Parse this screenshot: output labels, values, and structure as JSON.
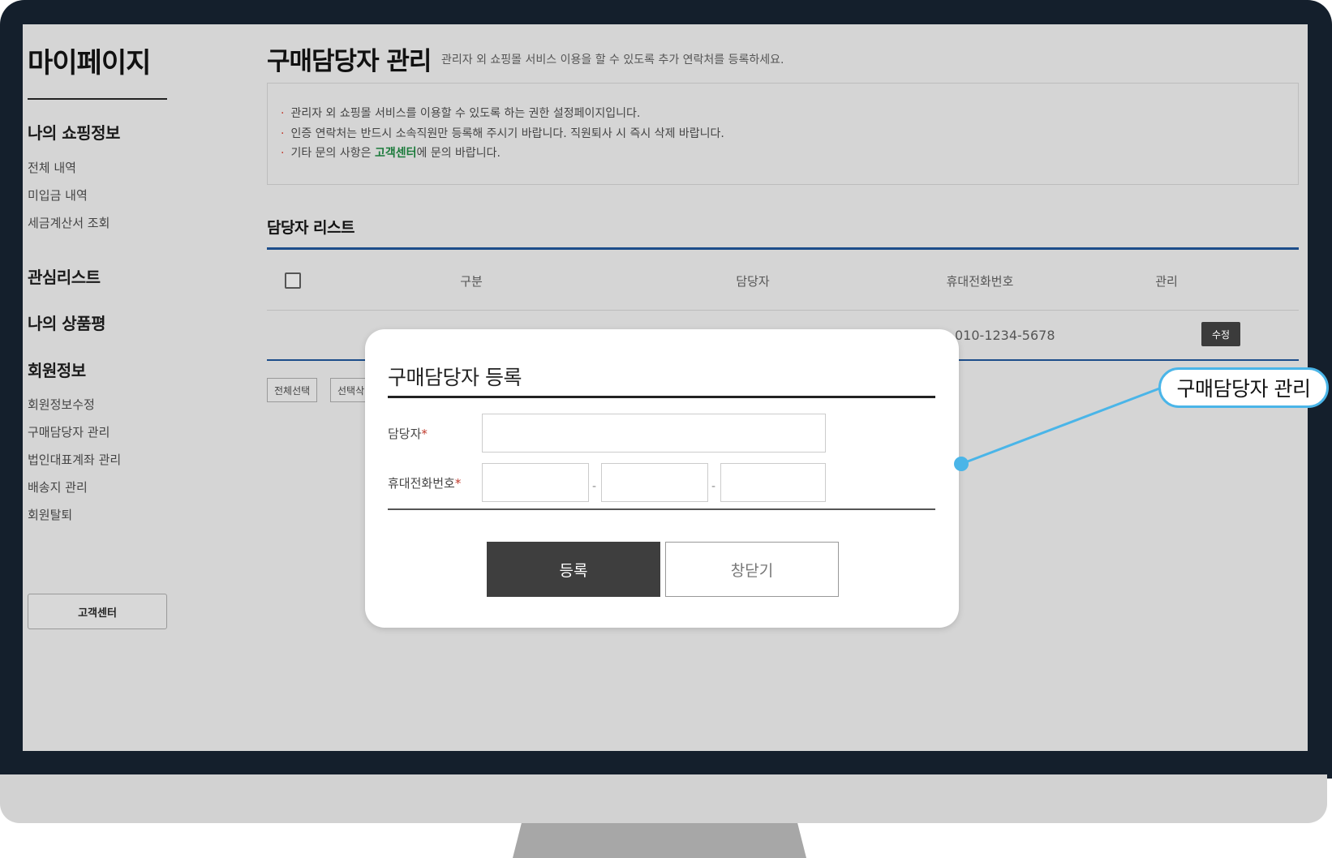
{
  "sidebar": {
    "title": "마이페이지",
    "sections": [
      {
        "heading": "나의 쇼핑정보",
        "links": [
          "전체 내역",
          "미입금 내역",
          "세금계산서 조회"
        ]
      },
      {
        "heading": "관심리스트",
        "links": []
      },
      {
        "heading": "나의 상품평",
        "links": []
      },
      {
        "heading": "회원정보",
        "links": [
          "회원정보수정",
          "구매담당자 관리",
          "법인대표계좌 관리",
          "배송지 관리",
          "회원탈퇴"
        ]
      }
    ],
    "customer_center": "고객센터"
  },
  "page": {
    "title": "구매담당자 관리",
    "description": "관리자 외 쇼핑몰 서비스 이용을 할 수 있도록 추가 연락처를 등록하세요."
  },
  "notice": {
    "bullet": "·",
    "lines": [
      "관리자 외 쇼핑몰 서비스를 이용할 수 있도록 하는 권한 설정페이지입니다.",
      "인증 연락처는 반드시 소속직원만 등록해 주시기 바랍니다. 직원퇴사 시 즉시 삭제 바랍니다."
    ],
    "line3_prefix": "기타 문의 사항은 ",
    "line3_link": "고객센터",
    "line3_suffix": "에 문의 바랍니다."
  },
  "list": {
    "title": "담당자 리스트",
    "columns": [
      "구분",
      "담당자",
      "휴대전화번호",
      "관리"
    ],
    "rows": [
      {
        "phone": "010-1234-5678",
        "action": "수정"
      }
    ],
    "buttons": [
      "전체선택",
      "선택삭"
    ]
  },
  "modal": {
    "title": "구매담당자 등록",
    "name_label": "담당자",
    "phone_label": "휴대전화번호",
    "required_mark": "*",
    "dash": "-",
    "submit": "등록",
    "close": "창닫기"
  },
  "callout": {
    "label": "구매담당자 관리",
    "color": "#4ab5e8"
  },
  "colors": {
    "accent_blue": "#1c4d8a",
    "required_red": "#c0392b",
    "link_green": "#1a7a3a",
    "bezel": "#141f2c"
  }
}
